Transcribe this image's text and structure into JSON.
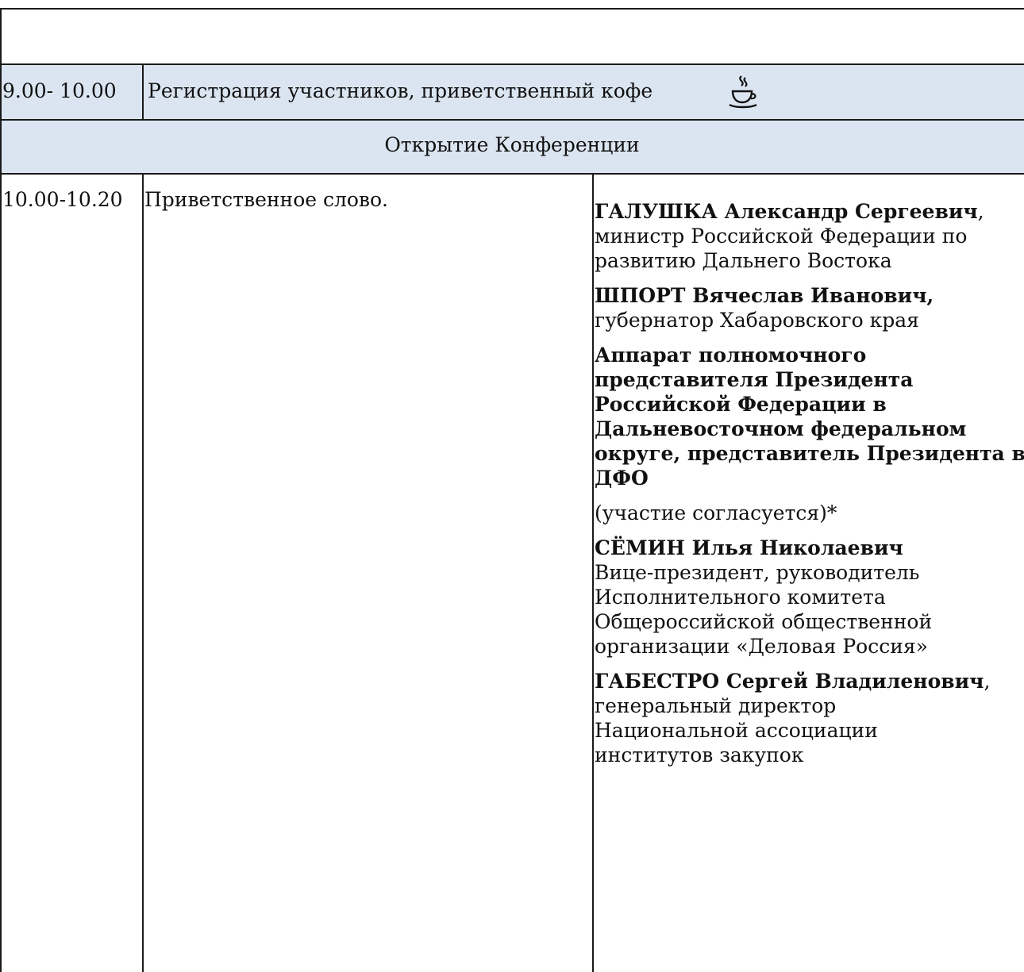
{
  "schedule": {
    "registration": {
      "time": "9.00- 10.00",
      "title": "Регистрация участников, приветственный кофе",
      "icon": "coffee-cup-icon"
    },
    "opening": {
      "title": "Открытие Конференции"
    },
    "welcome": {
      "time": "10.00-10.20",
      "title": "Приветственное слово.",
      "speakers": [
        {
          "name": "ГАЛУШКА Александр Сергеевич",
          "sep": ",",
          "role": "министр Российской Федерации по развитию Дальнего Востока"
        },
        {
          "name": "ШПОРТ Вячеслав Иванович,",
          "sep": "",
          "role": "губернатор Хабаровского края"
        },
        {
          "name": "Аппарат полномочного представителя Президента Российской Федерации в Дальневосточном федеральном округе, представитель Президента в ДФО",
          "sep": "",
          "role": ""
        },
        {
          "name": "",
          "sep": "",
          "role": "(участие согласуется)*"
        },
        {
          "name": "СЁМИН Илья Николаевич",
          "sep": "",
          "role": "Вице-президент, руководитель Исполнительного комитета Общероссийской общественной организации «Деловая Россия»"
        },
        {
          "name": "ГАБЕСТРО Сергей Владиленович",
          "sep": ",",
          "role": "генеральный директор Национальной ассоциации институтов закупок"
        }
      ]
    }
  },
  "colors": {
    "band": "#dbe5f1",
    "border": "#1a1a1a"
  }
}
